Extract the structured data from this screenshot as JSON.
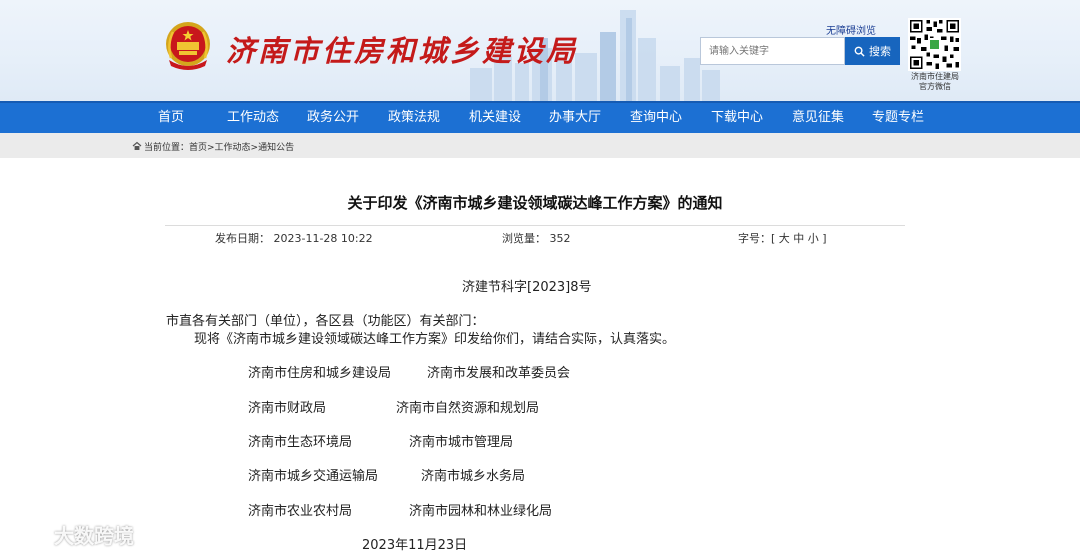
{
  "header": {
    "site_title": "济南市住房和城乡建设局",
    "accessibility_link": "无障碍浏览",
    "search_placeholder": "请输入关键字",
    "search_button": "搜索",
    "qr_caption_line1": "济南市住建局",
    "qr_caption_line2": "官方微信",
    "title_color": "#c41a1a"
  },
  "nav": {
    "items": [
      "首页",
      "工作动态",
      "政务公开",
      "政策法规",
      "机关建设",
      "办事大厅",
      "查询中心",
      "下载中心",
      "意见征集",
      "专题专栏"
    ],
    "color": "#1c70d3"
  },
  "breadcrumb": {
    "text": "当前位置：首页>工作动态>通知公告"
  },
  "article": {
    "title": "关于印发《济南市城乡建设领域碳达峰工作方案》的通知",
    "publish_label": "发布日期：",
    "publish_value": "2023-11-28 10:22",
    "views_label": "浏览量：",
    "views_value": "352",
    "fontsize_label": "字号：",
    "fontsize_open": "[",
    "fontsize_large": "大",
    "fontsize_medium": "中",
    "fontsize_small": "小",
    "fontsize_close": "]",
    "doc_number": "济建节科字[2023]8号",
    "recipients": "市直各有关部门（单位），各区县（功能区）有关部门：",
    "body": "现将《济南市城乡建设领域碳达峰工作方案》印发给你们，请结合实际，认真落实。",
    "signers": [
      [
        "济南市住房和城乡建设局",
        "济南市发展和改革委员会"
      ],
      [
        "济南市财政局",
        "济南市自然资源和规划局"
      ],
      [
        "济南市生态环境局",
        "济南市城市管理局"
      ],
      [
        "济南市城乡交通运输局",
        "济南市城乡水务局"
      ],
      [
        "济南市农业农村局",
        "济南市园林和林业绿化局"
      ]
    ],
    "date": "2023年11月23日"
  },
  "watermark": "大数跨境"
}
